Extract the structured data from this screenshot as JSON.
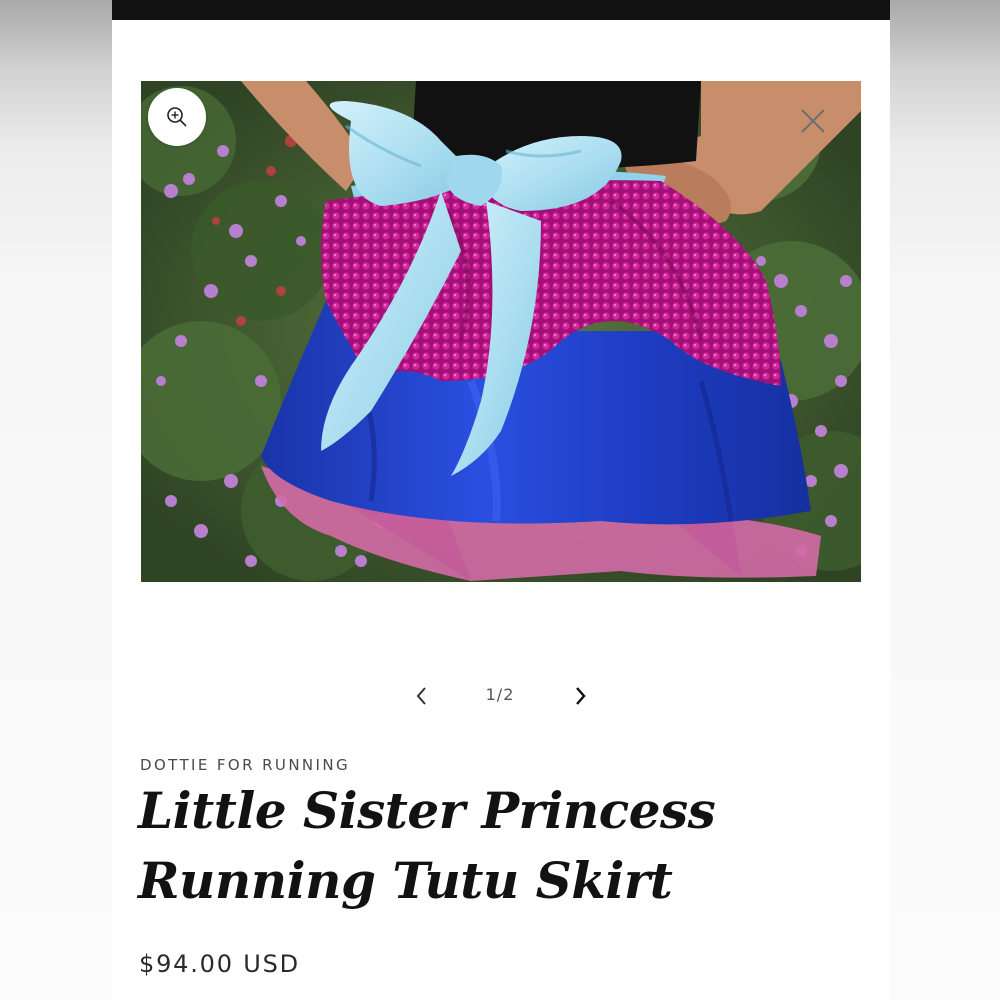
{
  "product": {
    "vendor": "DOTTIE FOR RUNNING",
    "title": "Little Sister Princess Running Tutu Skirt",
    "price": "$94.00 USD",
    "image_alt": "Little Sister Princess Running Tutu Skirt"
  },
  "gallery": {
    "counter": "1/2",
    "current": 1,
    "total": 2
  },
  "icons": {
    "zoom": "zoom-in-icon",
    "close": "close-icon",
    "prev": "chevron-left-icon",
    "next": "chevron-right-icon"
  },
  "colors": {
    "top_bar": "#111111",
    "text": "#121212",
    "skirt_blue": "#1f3fc4",
    "sequin_magenta": "#b0127f",
    "bow_light_blue": "#aee3f2",
    "tulle_pink": "#d46aa6"
  }
}
